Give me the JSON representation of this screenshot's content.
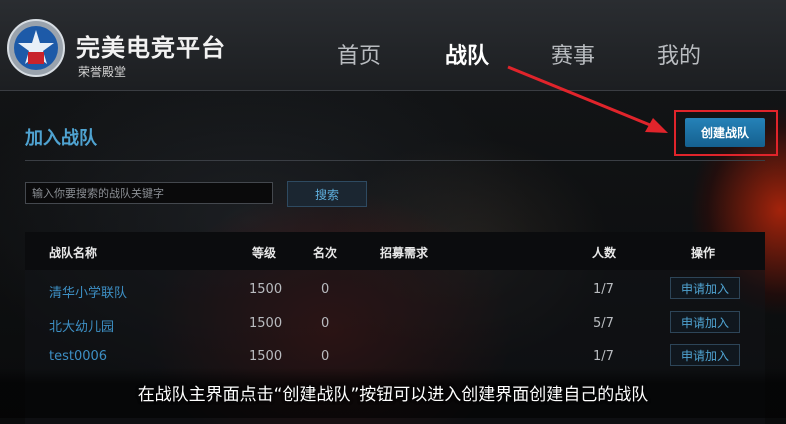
{
  "header": {
    "brand_title": "完美电竞平台",
    "brand_subtitle": "荣誉殿堂",
    "nav": [
      {
        "label": "首页",
        "active": false
      },
      {
        "label": "战队",
        "active": true
      },
      {
        "label": "赛事",
        "active": false
      },
      {
        "label": "我的",
        "active": false
      }
    ]
  },
  "main": {
    "section_title": "加入战队",
    "create_button": "创建战队",
    "search": {
      "placeholder": "输入你要搜索的战队关键字",
      "value": "",
      "button": "搜索"
    },
    "table": {
      "columns": [
        "战队名称",
        "等级",
        "名次",
        "招募需求",
        "人数",
        "操作"
      ],
      "rows": [
        {
          "name": "清华小学联队",
          "level": "1500",
          "rank": "0",
          "need": "",
          "members": "1/7",
          "action": "申请加入"
        },
        {
          "name": "北大幼儿园",
          "level": "1500",
          "rank": "0",
          "need": "",
          "members": "5/7",
          "action": "申请加入"
        },
        {
          "name": "test0006",
          "level": "1500",
          "rank": "0",
          "need": "",
          "members": "1/7",
          "action": "申请加入"
        }
      ]
    }
  },
  "annotation": {
    "caption": "在战队主界面点击“创建战队”按钮可以进入创建界面创建自己的战队",
    "highlight_color": "#e0242b"
  },
  "colors": {
    "accent": "#4fa3d1",
    "button": "#1d6fa0"
  }
}
